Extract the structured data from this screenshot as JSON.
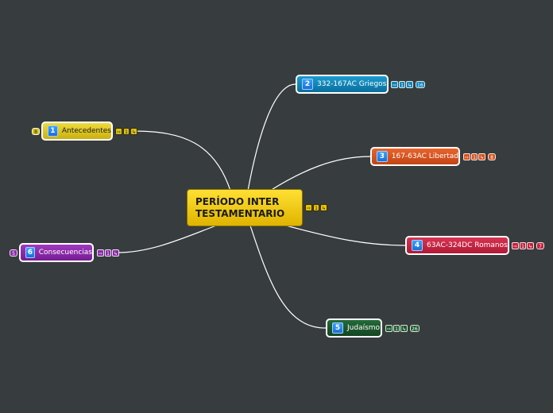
{
  "central": {
    "line1": "PERÍODO INTER",
    "line2": "TESTAMENTARIO",
    "color": "#f2c600",
    "badge_count": "1"
  },
  "nodes": [
    {
      "num": "1",
      "label": "Antecedentes",
      "color": "#d9c21a",
      "badge_count": "1",
      "side_count": "8"
    },
    {
      "num": "2",
      "label": "332-167AC Griegos",
      "color": "#0f86b8",
      "badge_count": "1",
      "side_count": "16"
    },
    {
      "num": "3",
      "label": "167-63AC Libertad",
      "color": "#d8521e",
      "badge_count": "1",
      "side_count": "8"
    },
    {
      "num": "4",
      "label": "63AC-324DC Romanos",
      "color": "#c6223d",
      "badge_count": "1",
      "side_count": "7"
    },
    {
      "num": "5",
      "label": "Judaísmo",
      "color": "#1c5a2e",
      "badge_count": "1",
      "side_count": "26"
    },
    {
      "num": "6",
      "label": "Consecuencias",
      "color": "#8a2aa8",
      "badge_count": "1",
      "side_count": "5"
    }
  ],
  "icons": {
    "link": "link-icon",
    "note": "note-icon"
  }
}
